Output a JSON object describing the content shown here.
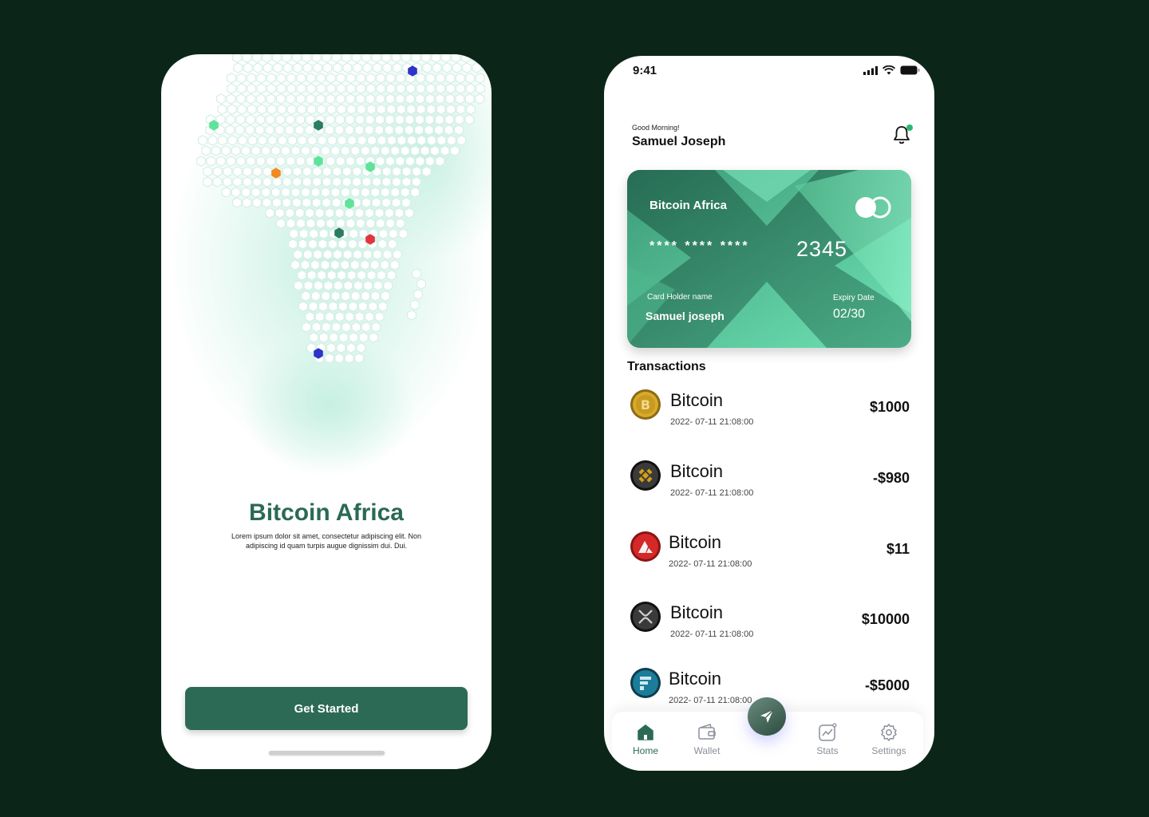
{
  "onboarding": {
    "title": "Bitcoin Africa",
    "description": "Lorem ipsum dolor sit amet, consectetur adipiscing elit. Non adipiscing id quam turpis augue dignissim dui. Dui.",
    "cta_label": "Get Started"
  },
  "status_bar": {
    "time": "9:41"
  },
  "header": {
    "greeting": "Good Morning!",
    "user_name": "Samuel Joseph"
  },
  "card": {
    "brand": "Bitcoin Africa",
    "masked": "**** **** ****",
    "last_digits": "2345",
    "holder_label": "Card Holder name",
    "holder_name": "Samuel joseph",
    "expiry_label": "Expiry Date",
    "expiry": "02/30"
  },
  "transactions": {
    "title": "Transactions",
    "items": [
      {
        "name": "Bitcoin",
        "date": "2022- 07-11 21:08:00",
        "amount": "$1000",
        "coin_icon": "bitcoin-coin-icon",
        "color": "#d4a017"
      },
      {
        "name": "Bitcoin",
        "date": "2022- 07-11 21:08:00",
        "amount": "-$980",
        "coin_icon": "binance-coin-icon",
        "color": "#2b2b2b"
      },
      {
        "name": "Bitcoin",
        "date": "2022- 07-11 21:08:00",
        "amount": "$11",
        "coin_icon": "avalanche-coin-icon",
        "color": "#d62828"
      },
      {
        "name": "Bitcoin",
        "date": "2022- 07-11 21:08:00",
        "amount": "$10000",
        "coin_icon": "xrp-coin-icon",
        "color": "#2b2b2b"
      },
      {
        "name": "Bitcoin",
        "date": "2022- 07-11 21:08:00",
        "amount": "-$5000",
        "coin_icon": "ftx-coin-icon",
        "color": "#1b6f8a"
      }
    ]
  },
  "nav": {
    "home": "Home",
    "wallet": "Wallet",
    "stats": "Stats",
    "settings": "Settings"
  },
  "colors": {
    "background": "#0b2618",
    "accent": "#2c6a55",
    "card_gradient_start": "#2f8a6a",
    "card_gradient_end": "#6ee7b7"
  }
}
